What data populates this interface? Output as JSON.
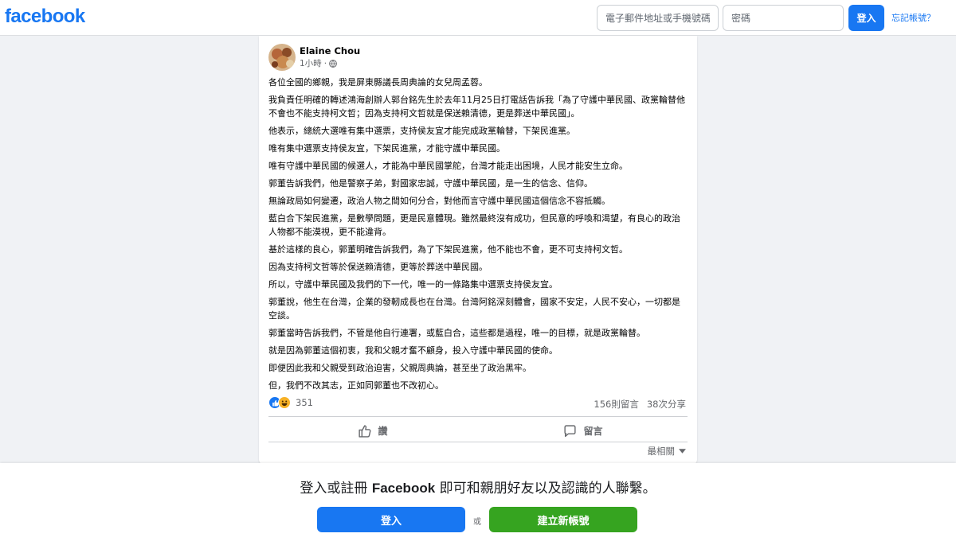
{
  "header": {
    "logo": "facebook",
    "email_placeholder": "電子郵件地址或手機號碼",
    "password_placeholder": "密碼",
    "login_label": "登入",
    "forgot_label": "忘記帳號？"
  },
  "post": {
    "author": "Elaine Chou",
    "time": "1小時",
    "privacy_icon": "globe-icon",
    "paragraphs": [
      "各位全國的鄉親，我是屏東縣議長周典論的女兒周孟蓉。",
      "我負責任明確的轉述鴻海創辦人郭台銘先生於去年11月25日打電話告訴我「為了守護中華民國、政黨輪替他不會也不能支持柯文哲；因為支持柯文哲就是保送賴清德，更是葬送中華民國」。",
      "他表示，總統大選唯有集中選票，支持侯友宜才能完成政黨輪替，下架民進黨。",
      "唯有集中選票支持侯友宜，下架民進黨，才能守護中華民國。",
      "唯有守護中華民國的候選人，才能為中華民國掌舵，台灣才能走出困境，人民才能安生立命。",
      "郭董告訴我們，他是警察子弟，對國家忠誠，守護中華民國，是一生的信念、信仰。",
      "無論政局如何變遷，政治人物之間如何分合，對他而言守護中華民國這個信念不容抵觸。",
      "藍白合下架民進黨，是數學問題，更是民意體現。雖然最終沒有成功，但民意的呼喚和渴望，有良心的政治人物都不能漠視，更不能違背。",
      "基於這樣的良心，郭董明確告訴我們，為了下架民進黨，他不能也不會，更不可支持柯文哲。",
      "因為支持柯文哲等於保送賴清德，更等於葬送中華民國。",
      "所以，守護中華民國及我們的下一代，唯一的一條路集中選票支持侯友宜。",
      "郭董說，他生在台灣，企業的發軔成長也在台灣。台灣阿銘深刻體會，國家不安定，人民不安心，一切都是空談。",
      "郭董當時告訴我們，不管是他自行連署，或藍白合，這些都是過程，唯一的目標，就是政黨輪替。",
      "就是因為郭董這個初衷，我和父親才奮不顧身，投入守護中華民國的使命。",
      "即便因此我和父親受到政治迫害，父親周典論，甚至坐了政治黑牢。",
      "但，我們不改其志，正如同郭董也不改初心。"
    ],
    "reaction_count": "351",
    "comments": "156則留言",
    "shares": "38次分享",
    "like_label": "讚",
    "comment_label": "留言",
    "sort_label": "最相關"
  },
  "bottom": {
    "msg_prefix": "登入或註冊 ",
    "msg_brand": "Facebook",
    "msg_suffix": " 即可和親朋好友以及認識的人聯繫。",
    "login_label": "登入",
    "or_label": "或",
    "register_label": "建立新帳號"
  },
  "colors": {
    "brand_blue": "#1877f2",
    "register_green": "#36a420",
    "page_bg": "#f0f2f5"
  }
}
